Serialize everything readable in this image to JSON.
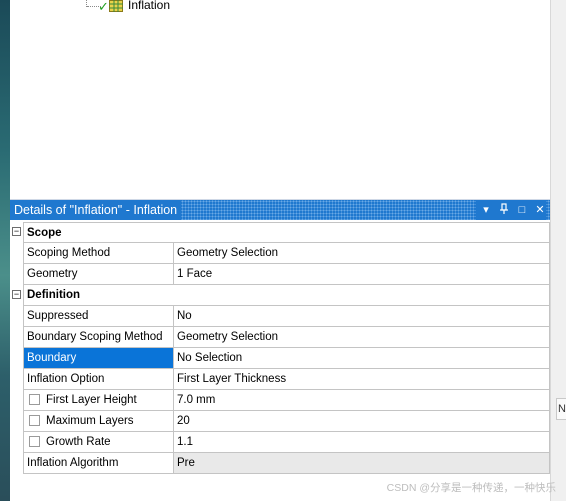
{
  "tree": {
    "item_label": "Inflation"
  },
  "details": {
    "title": "Details of \"Inflation\" - Inflation",
    "controls": {
      "dropdown": "▾",
      "pin": "ᵖ",
      "maximize": "□",
      "close": "✕"
    },
    "groups": [
      {
        "name": "Scope",
        "toggle": "−",
        "rows": [
          {
            "key": "Scoping Method",
            "value": "Geometry Selection"
          },
          {
            "key": "Geometry",
            "value": "1 Face"
          }
        ]
      },
      {
        "name": "Definition",
        "toggle": "−",
        "rows": [
          {
            "key": "Suppressed",
            "value": "No"
          },
          {
            "key": "Boundary Scoping Method",
            "value": "Geometry Selection"
          },
          {
            "key": "Boundary",
            "value": "No Selection"
          },
          {
            "key": "Inflation Option",
            "value": "First Layer Thickness"
          },
          {
            "key": "First Layer Height",
            "value": "7.0 mm"
          },
          {
            "key": "Maximum Layers",
            "value": "20"
          },
          {
            "key": "Growth Rate",
            "value": "1.1"
          },
          {
            "key": "Inflation Algorithm",
            "value": "Pre"
          }
        ]
      }
    ]
  },
  "right_panel": {
    "ghost_text": "N"
  },
  "watermark": "CSDN @分享是一种传递，一种快乐"
}
